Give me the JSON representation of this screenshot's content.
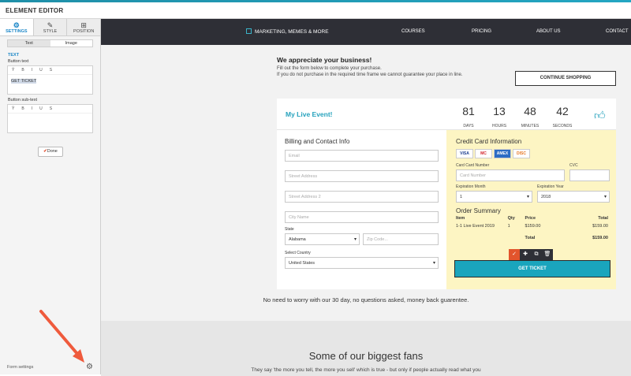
{
  "editor": {
    "title": "ELEMENT EDITOR",
    "tabs": [
      {
        "label": "SETTINGS",
        "icon": "gear-icon",
        "glyph": "⚙"
      },
      {
        "label": "STYLE",
        "icon": "brush-icon",
        "glyph": "✎"
      },
      {
        "label": "POSITION",
        "icon": "grid-icon",
        "glyph": "⊞"
      }
    ],
    "segments": [
      "Text",
      "Image"
    ],
    "section_label": "TEXT",
    "button_text_label": "Button text",
    "button_text_value": "GET TICKET",
    "button_subtext_label": "Button sub-text",
    "button_subtext_value": "",
    "rte_tools": [
      "Ȳ",
      "B",
      "I",
      "U",
      "S"
    ],
    "done_label": "Done",
    "form_settings_label": "Form settings"
  },
  "nav": {
    "logo": "MARKETING, MEMES & MORE",
    "links": [
      "COURSES",
      "PRICING",
      "ABOUT US",
      "CONTACT"
    ]
  },
  "intro": {
    "heading": "We appreciate your business!",
    "line1": "Fill out the form below to complete your purchase.",
    "line2": "If you do not purchase in the required time frame we cannot guarantee your place in line.",
    "continue_label": "CONTINUE SHOPPING"
  },
  "event": {
    "title": "My Live Event!",
    "countdown": [
      {
        "value": "81",
        "unit": "DAYS"
      },
      {
        "value": "13",
        "unit": "HOURS"
      },
      {
        "value": "48",
        "unit": "MINUTES"
      },
      {
        "value": "42",
        "unit": "SECONDS"
      }
    ]
  },
  "billing": {
    "heading": "Billing and Contact Info",
    "email_ph": "Email",
    "street_ph": "Street Address",
    "street2_ph": "Street Address 2",
    "city_ph": "City Name",
    "state_label": "State",
    "state_value": "Alabama",
    "zip_ph": "Zip Code...",
    "country_label": "Select Country",
    "country_value": "United States"
  },
  "payment": {
    "heading": "Credit Card Information",
    "card_brands": [
      "VISA",
      "MC",
      "AMEX",
      "DISC"
    ],
    "card_number_label": "Card Card Number",
    "card_number_ph": "Card Number",
    "cvc_label": "CVC",
    "exp_month_label": "Expiration Month",
    "exp_month_value": "1",
    "exp_year_label": "Expiration Year",
    "exp_year_value": "2018"
  },
  "order": {
    "heading": "Order Summary",
    "cols": [
      "Item",
      "Qty",
      "Price",
      "Total"
    ],
    "row": [
      "1-1 Live Event 2019",
      "1",
      "$159.00",
      "$159.00"
    ],
    "total_label": "Total",
    "total_value": "$159.00"
  },
  "toolbar": [
    "✓",
    "✚",
    "⧉",
    "🗑"
  ],
  "get_ticket": "GET TICKET",
  "guarantee": "No need to worry with our 30 day, no questions asked, money back guarentee.",
  "fans": {
    "heading": "Some of our biggest fans",
    "text": "They say 'the more you tell, the more you sell' which is true - but only if people actually read what you"
  }
}
